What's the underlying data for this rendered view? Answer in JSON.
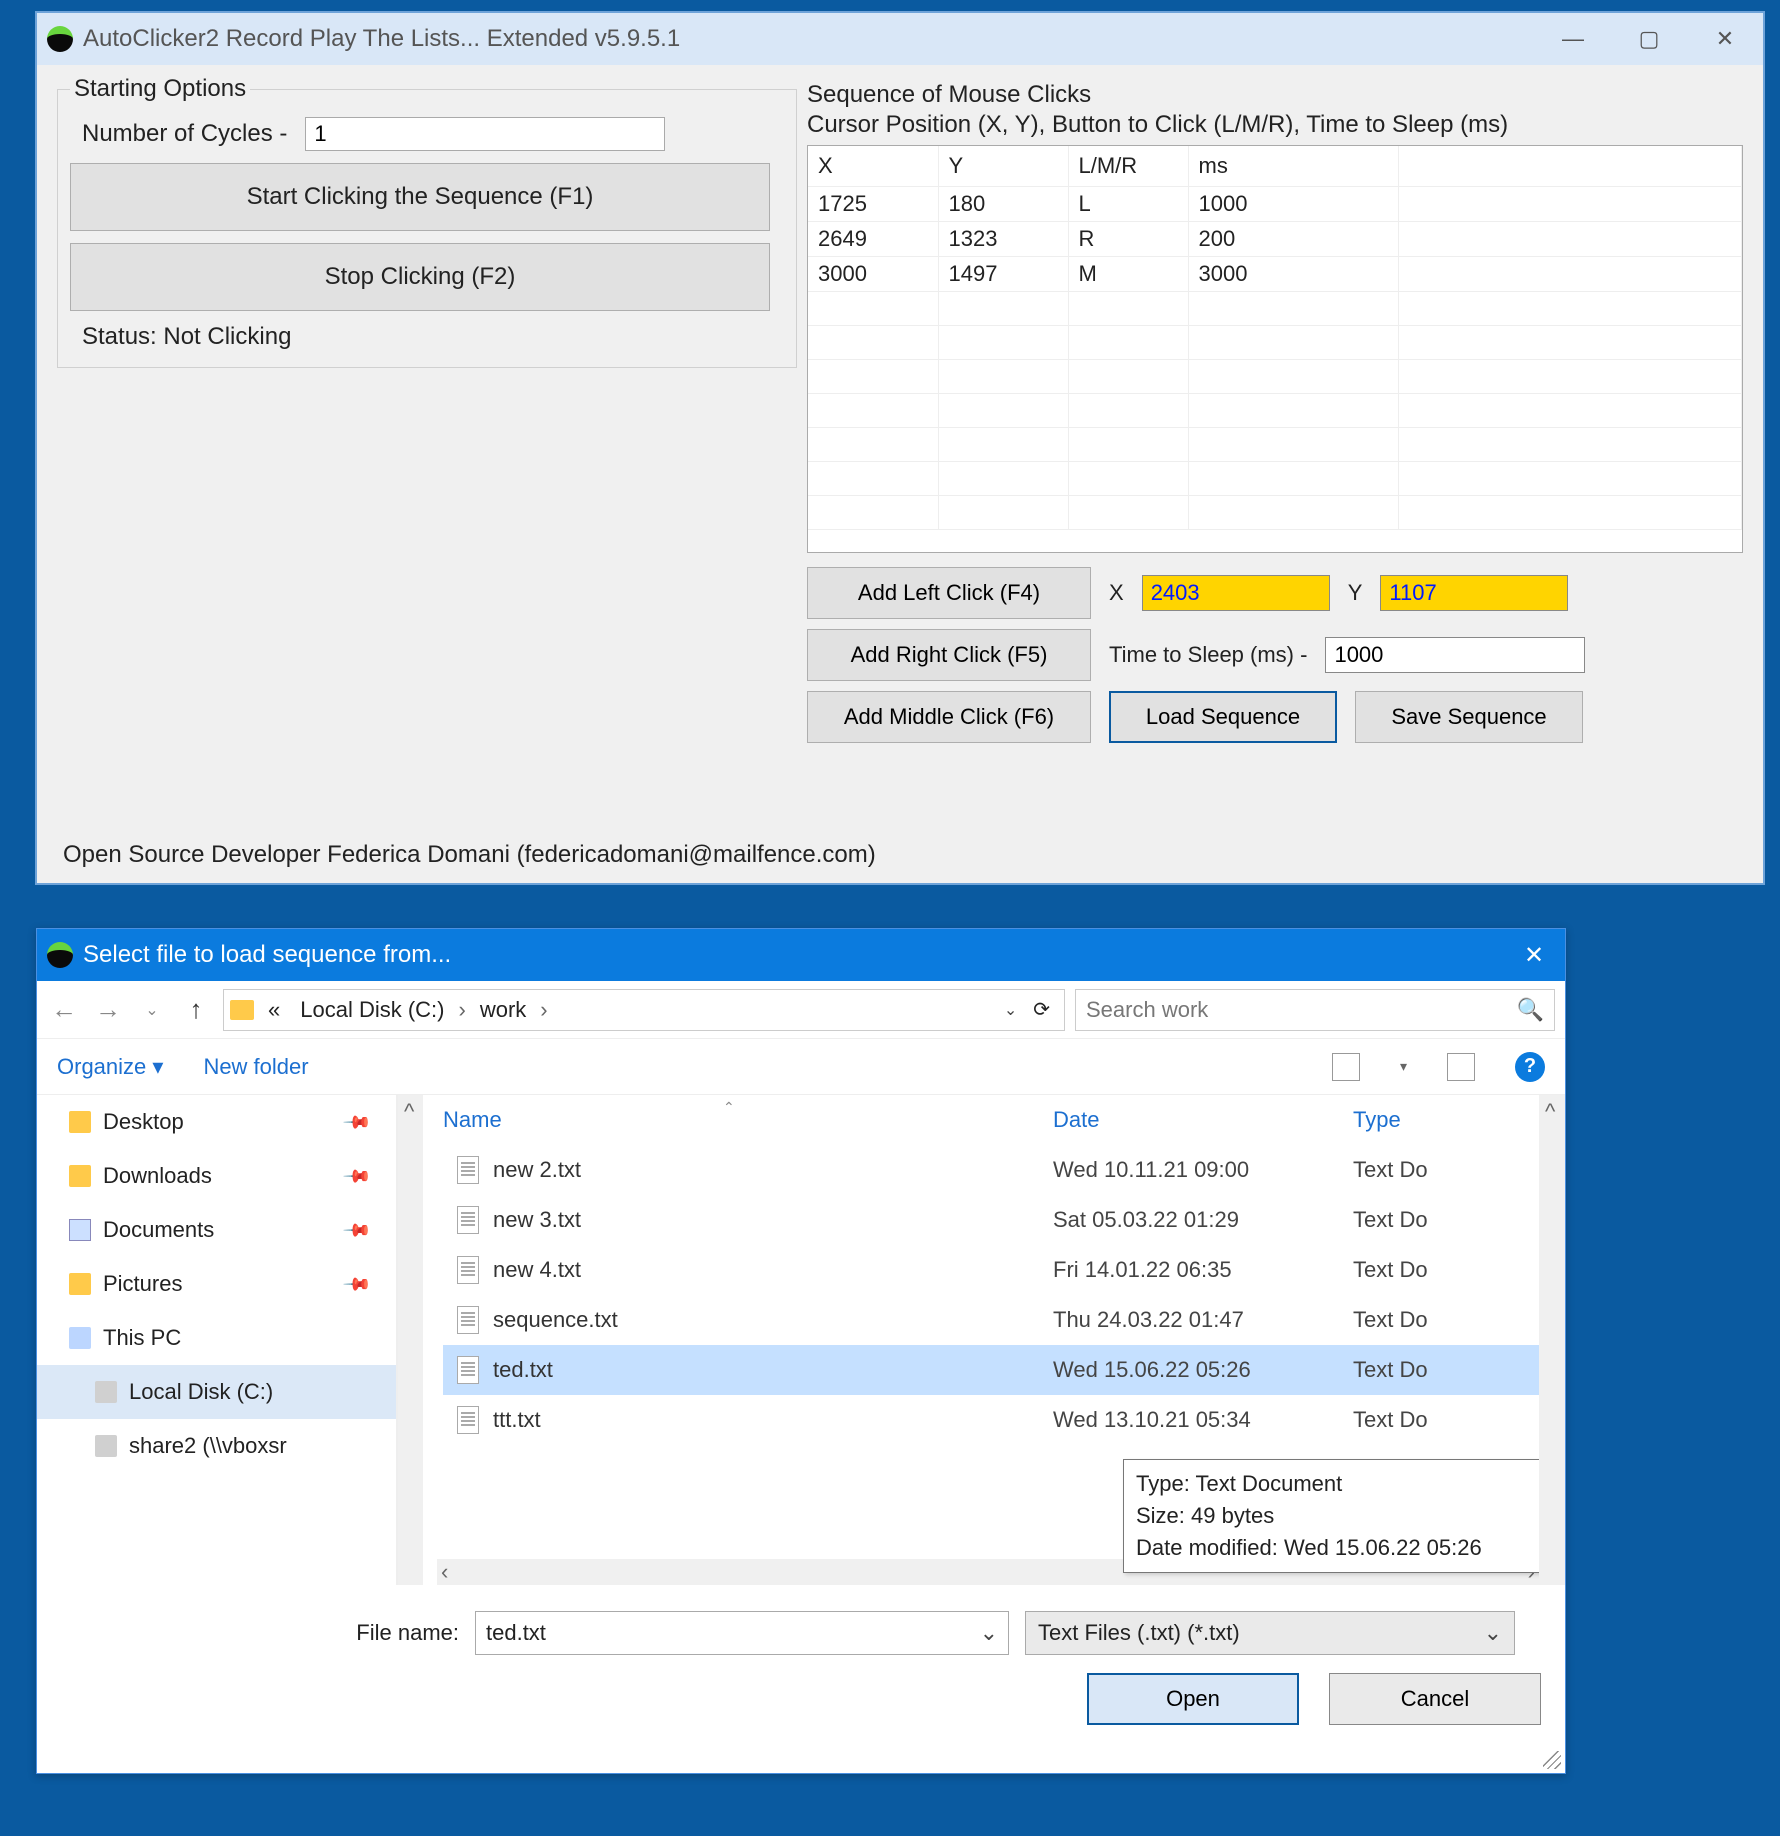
{
  "app": {
    "title": "AutoClicker2 Record Play The Lists... Extended v5.9.5.1",
    "starting": {
      "legend": "Starting Options",
      "num_cycles_label": "Number of Cycles -",
      "num_cycles_value": "1",
      "start_btn": "Start Clicking the Sequence (F1)",
      "stop_btn": "Stop Clicking (F2)",
      "status": "Status: Not Clicking"
    },
    "sequence": {
      "header": "Sequence of Mouse Clicks",
      "subheader": "Cursor Position (X, Y), Button to Click (L/M/R), Time to Sleep (ms)",
      "columns": {
        "x": "X",
        "y": "Y",
        "lmr": "L/M/R",
        "ms": "ms"
      },
      "rows": [
        {
          "x": "1725",
          "y": "180",
          "lmr": "L",
          "ms": "1000"
        },
        {
          "x": "2649",
          "y": "1323",
          "lmr": "R",
          "ms": "200"
        },
        {
          "x": "3000",
          "y": "1497",
          "lmr": "M",
          "ms": "3000"
        }
      ]
    },
    "controls": {
      "add_left": "Add Left Click (F4)",
      "add_right": "Add Right Click (F5)",
      "add_middle": "Add Middle Click (F6)",
      "x_label": "X",
      "x_value": "2403",
      "y_label": "Y",
      "y_value": "1107",
      "sleep_label": "Time to Sleep (ms) -",
      "sleep_value": "1000",
      "load_btn": "Load Sequence",
      "save_btn": "Save Sequence"
    },
    "footer": "Open Source Developer Federica Domani (federicadomani@mailfence.com)"
  },
  "dialog": {
    "title": "Select file to load sequence from...",
    "breadcrumb": {
      "prefix": "«",
      "seg1": "Local Disk (C:)",
      "seg2": "work"
    },
    "search_placeholder": "Search work",
    "toolbar": {
      "organize": "Organize ▾",
      "new_folder": "New folder"
    },
    "sidebar": [
      {
        "label": "Desktop",
        "icon": "folder",
        "pinned": true
      },
      {
        "label": "Downloads",
        "icon": "folder",
        "pinned": true
      },
      {
        "label": "Documents",
        "icon": "docs",
        "pinned": true
      },
      {
        "label": "Pictures",
        "icon": "folder",
        "pinned": true
      },
      {
        "label": "This PC",
        "icon": "pc",
        "pinned": false
      },
      {
        "label": "Local Disk (C:)",
        "icon": "disk",
        "pinned": false,
        "selected": true,
        "indent": true
      },
      {
        "label": "share2 (\\\\vboxsr",
        "icon": "disk",
        "pinned": false,
        "indent": true
      }
    ],
    "columns": {
      "name": "Name",
      "date": "Date",
      "type": "Type"
    },
    "files": [
      {
        "name": "new 2.txt",
        "date": "Wed 10.11.21 09:00",
        "type": "Text Do"
      },
      {
        "name": "new 3.txt",
        "date": "Sat 05.03.22 01:29",
        "type": "Text Do"
      },
      {
        "name": "new 4.txt",
        "date": "Fri 14.01.22 06:35",
        "type": "Text Do"
      },
      {
        "name": "sequence.txt",
        "date": "Thu 24.03.22 01:47",
        "type": "Text Do"
      },
      {
        "name": "ted.txt",
        "date": "Wed 15.06.22 05:26",
        "type": "Text Do",
        "selected": true
      },
      {
        "name": "ttt.txt",
        "date": "Wed 13.10.21 05:34",
        "type": "Text Do"
      }
    ],
    "tooltip": {
      "line1": "Type: Text Document",
      "line2": "Size: 49 bytes",
      "line3": "Date modified: Wed 15.06.22 05:26"
    },
    "footer": {
      "filename_label": "File name:",
      "filename_value": "ted.txt",
      "filetype": "Text Files (.txt) (*.txt)",
      "open": "Open",
      "cancel": "Cancel"
    }
  }
}
